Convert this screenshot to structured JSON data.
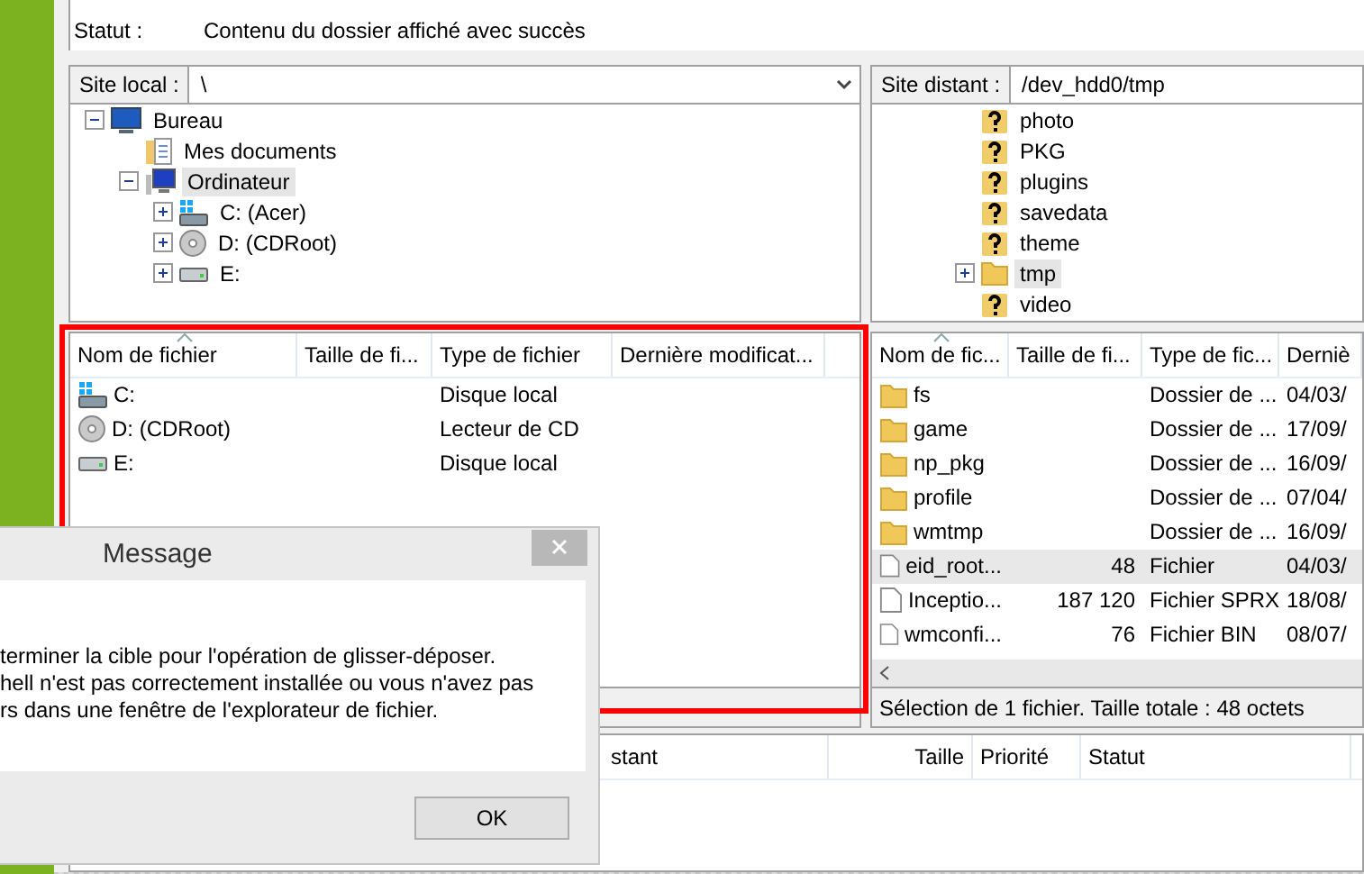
{
  "log": [
    {
      "label": "Statut :",
      "text": "Contenu du dossier affiché avec succès"
    }
  ],
  "local": {
    "site_label": "Site local :",
    "path": "\\",
    "tree": [
      {
        "label": "Bureau",
        "kind": "monitor",
        "expanded": true,
        "selected": false,
        "children": [
          {
            "label": "Mes documents",
            "kind": "documents",
            "selected": false
          },
          {
            "label": "Ordinateur",
            "kind": "computer",
            "expanded": true,
            "selected": true,
            "children": [
              {
                "label": "C: (Acer)",
                "kind": "windows-drive",
                "expanded": false,
                "selected": false
              },
              {
                "label": "D: (CDRoot)",
                "kind": "cd",
                "expanded": false,
                "selected": false
              },
              {
                "label": "E:",
                "kind": "drive",
                "expanded": false,
                "selected": false
              }
            ]
          }
        ]
      }
    ],
    "columns": [
      {
        "label": "Nom de fichier",
        "sorted": true
      },
      {
        "label": "Taille de fi...",
        "sorted": false
      },
      {
        "label": "Type de fichier",
        "sorted": false
      },
      {
        "label": "Dernière modificat...",
        "sorted": false
      }
    ],
    "files": [
      {
        "name": "C:",
        "kind": "windows-drive",
        "type": "Disque local",
        "selected": false
      },
      {
        "name": "D: (CDRoot)",
        "kind": "cd",
        "type": "Lecteur de CD",
        "selected": false
      },
      {
        "name": "E:",
        "kind": "drive",
        "type": "Disque local",
        "selected": false
      }
    ]
  },
  "remote": {
    "site_label": "Site distant :",
    "path": "/dev_hdd0/tmp",
    "tree": [
      {
        "label": "photo",
        "kind": "unknown",
        "selected": false
      },
      {
        "label": "PKG",
        "kind": "unknown",
        "selected": false
      },
      {
        "label": "plugins",
        "kind": "unknown",
        "selected": false
      },
      {
        "label": "savedata",
        "kind": "unknown",
        "selected": false
      },
      {
        "label": "theme",
        "kind": "unknown",
        "selected": false
      },
      {
        "label": "tmp",
        "kind": "folder",
        "expanded": false,
        "selected": true
      },
      {
        "label": "video",
        "kind": "unknown",
        "selected": false
      }
    ],
    "columns": [
      {
        "label": "Nom de fic...",
        "sorted": true
      },
      {
        "label": "Taille de fi...",
        "sorted": false
      },
      {
        "label": "Type de fic...",
        "sorted": false
      },
      {
        "label": "Derniè",
        "sorted": false
      }
    ],
    "files": [
      {
        "name": "fs",
        "kind": "folder",
        "type": "Dossier de ...",
        "modified": "04/03/",
        "selected": false
      },
      {
        "name": "game",
        "kind": "folder",
        "type": "Dossier de ...",
        "modified": "17/09/",
        "selected": false
      },
      {
        "name": "np_pkg",
        "kind": "folder",
        "type": "Dossier de ...",
        "modified": "16/09/",
        "selected": false
      },
      {
        "name": "profile",
        "kind": "folder",
        "type": "Dossier de ...",
        "modified": "07/04/",
        "selected": false
      },
      {
        "name": "wmtmp",
        "kind": "folder",
        "type": "Dossier de ...",
        "modified": "16/09/",
        "selected": false
      },
      {
        "name": "eid_root...",
        "kind": "file",
        "size": "48",
        "type": "Fichier",
        "modified": "04/03/",
        "selected": true
      },
      {
        "name": "Inceptio...",
        "kind": "file",
        "size": "187 120",
        "type": "Fichier SPRX",
        "modified": "18/08/",
        "selected": false
      },
      {
        "name": "wmconfi...",
        "kind": "file",
        "size": "76",
        "type": "Fichier BIN",
        "modified": "08/07/",
        "selected": false
      }
    ],
    "status": "Sélection de 1 fichier. Taille totale : 48 octets"
  },
  "queue": {
    "columns": [
      "stant",
      "Taille",
      "Priorité",
      "Statut"
    ]
  },
  "dialog": {
    "title": "Message",
    "lines": [
      "terminer la cible pour l'opération de glisser-déposer.",
      "hell n'est pas correctement installée ou vous n'avez pas",
      "rs dans une fenêtre de l'explorateur de fichier."
    ],
    "button": "OK"
  }
}
